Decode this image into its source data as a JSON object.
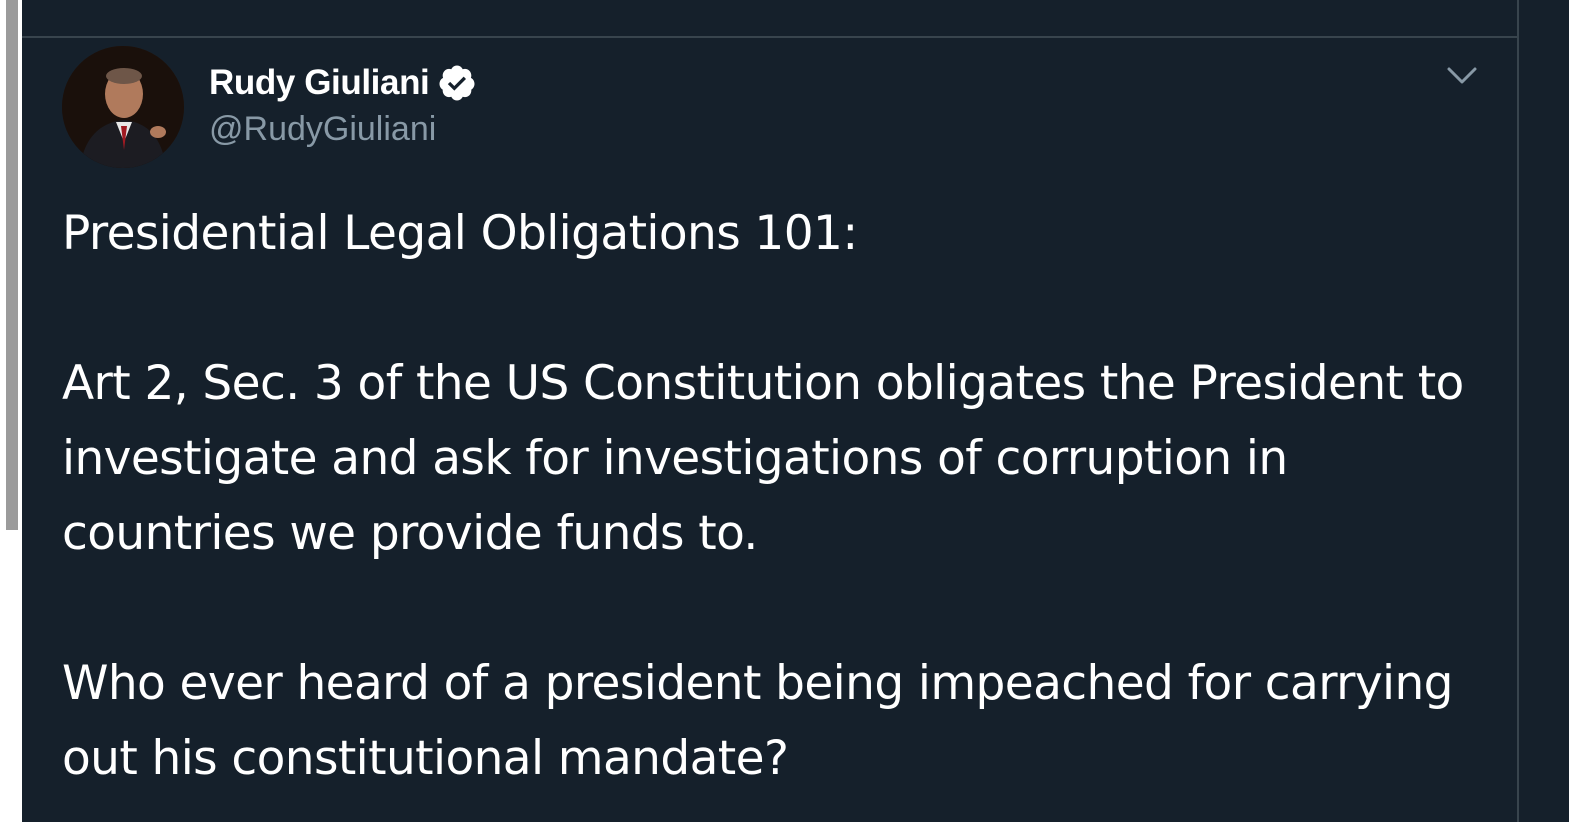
{
  "tweet": {
    "author": {
      "name": "Rudy Giuliani",
      "handle": "@RudyGiuliani",
      "verified": true,
      "avatar_icon": "profile-photo"
    },
    "menu_icon": "chevron-down-icon",
    "paragraphs": [
      "Presidential Legal Obligations 101:",
      "Art 2, Sec. 3 of the US Constitution obligates the President to investigate and ask for investigations of corruption in countries we provide funds to.",
      "Who ever heard of a president being impeached for carrying out his constitutional mandate?"
    ]
  },
  "colors": {
    "background": "#15202b",
    "border": "#38444d",
    "text_primary": "#ffffff",
    "text_secondary": "#8899a6",
    "verified_badge": "#ffffff"
  }
}
